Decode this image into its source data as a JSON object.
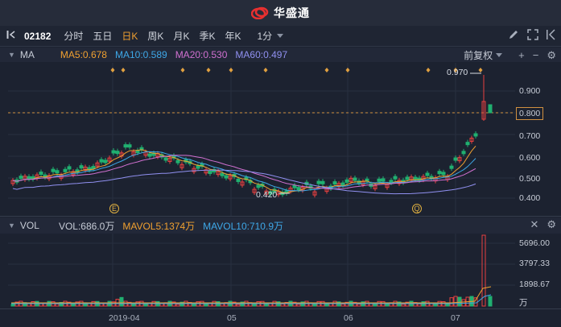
{
  "app": {
    "brand": "华盛通"
  },
  "toolbar": {
    "stock_code": "02182",
    "tabs": [
      "分时",
      "五日",
      "日K",
      "周K",
      "月K",
      "季K",
      "年K"
    ],
    "active_tab": "日K",
    "period": "1分"
  },
  "main_indicator": {
    "name": "MA",
    "ma5": "MA5:0.678",
    "ma10": "MA10:0.589",
    "ma20": "MA20:0.530",
    "ma60": "MA60:0.497",
    "adjust": "前复权",
    "colors": {
      "ma5": "#f0a030",
      "ma10": "#3ea8e8",
      "ma20": "#d070d0",
      "ma60": "#9090f0"
    }
  },
  "price_axis": [
    "0.900",
    "0.800",
    "0.700",
    "0.600",
    "0.500",
    "0.400"
  ],
  "price_axis_current": "0.800",
  "annotations": {
    "high": "0.970",
    "low": "0.420",
    "event_e": "E",
    "event_q": "Q"
  },
  "volume_indicator": {
    "name": "VOL",
    "vol": "VOL:686.0万",
    "mavol5": "MAVOL5:1374万",
    "mavol10": "MAVOL10:710.9万",
    "colors": {
      "mavol5": "#f0a030",
      "mavol10": "#3ea8e8"
    }
  },
  "volume_axis": [
    "5696.00",
    "3797.33",
    "1898.67",
    "万"
  ],
  "date_axis": [
    "2019-04",
    "05",
    "06",
    "07"
  ],
  "colors": {
    "up": "#e84040",
    "down": "#20b070",
    "background": "#1c2230"
  }
}
